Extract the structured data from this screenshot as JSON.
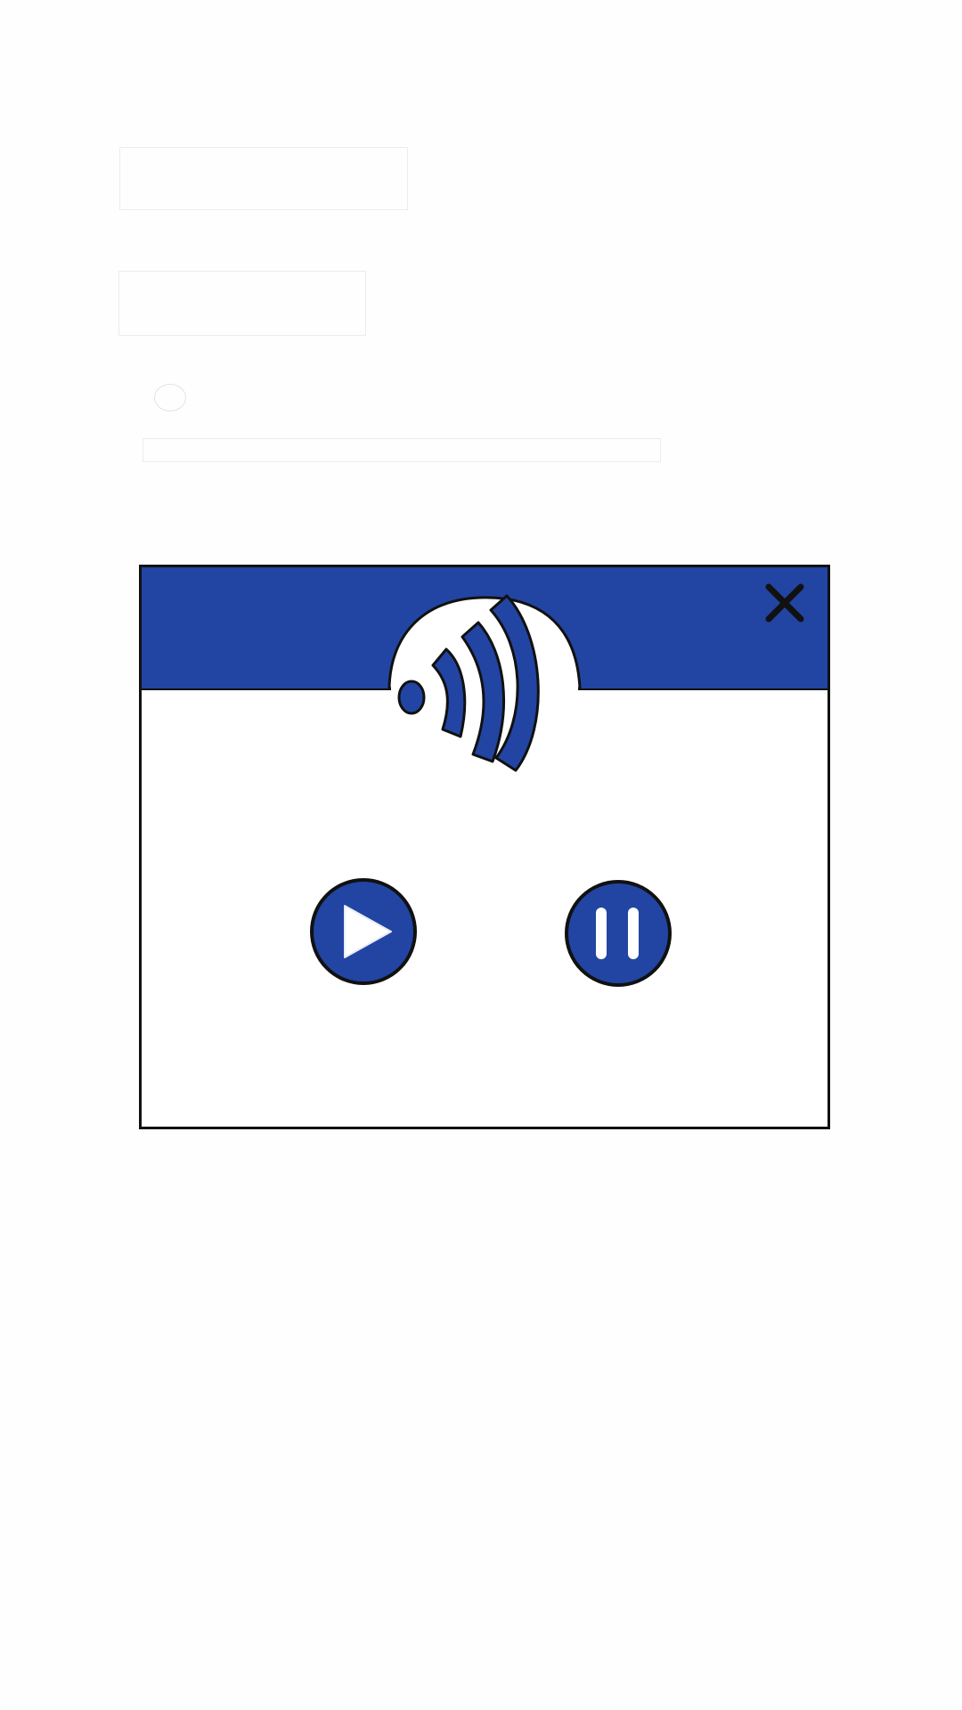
{
  "background": {
    "placeholders": [
      "ghost-box",
      "ghost-box",
      "ghost-radio",
      "ghost-bar"
    ]
  },
  "dialog": {
    "header_color": "#2245a3",
    "logo_icon": "sound-wave-icon",
    "close_icon": "close-icon",
    "controls": [
      {
        "name": "play-button",
        "icon": "play-icon"
      },
      {
        "name": "pause-button",
        "icon": "pause-icon"
      }
    ]
  },
  "colors": {
    "accent": "#2245a3",
    "outline": "#111111",
    "icon_fill": "#ffffff"
  }
}
